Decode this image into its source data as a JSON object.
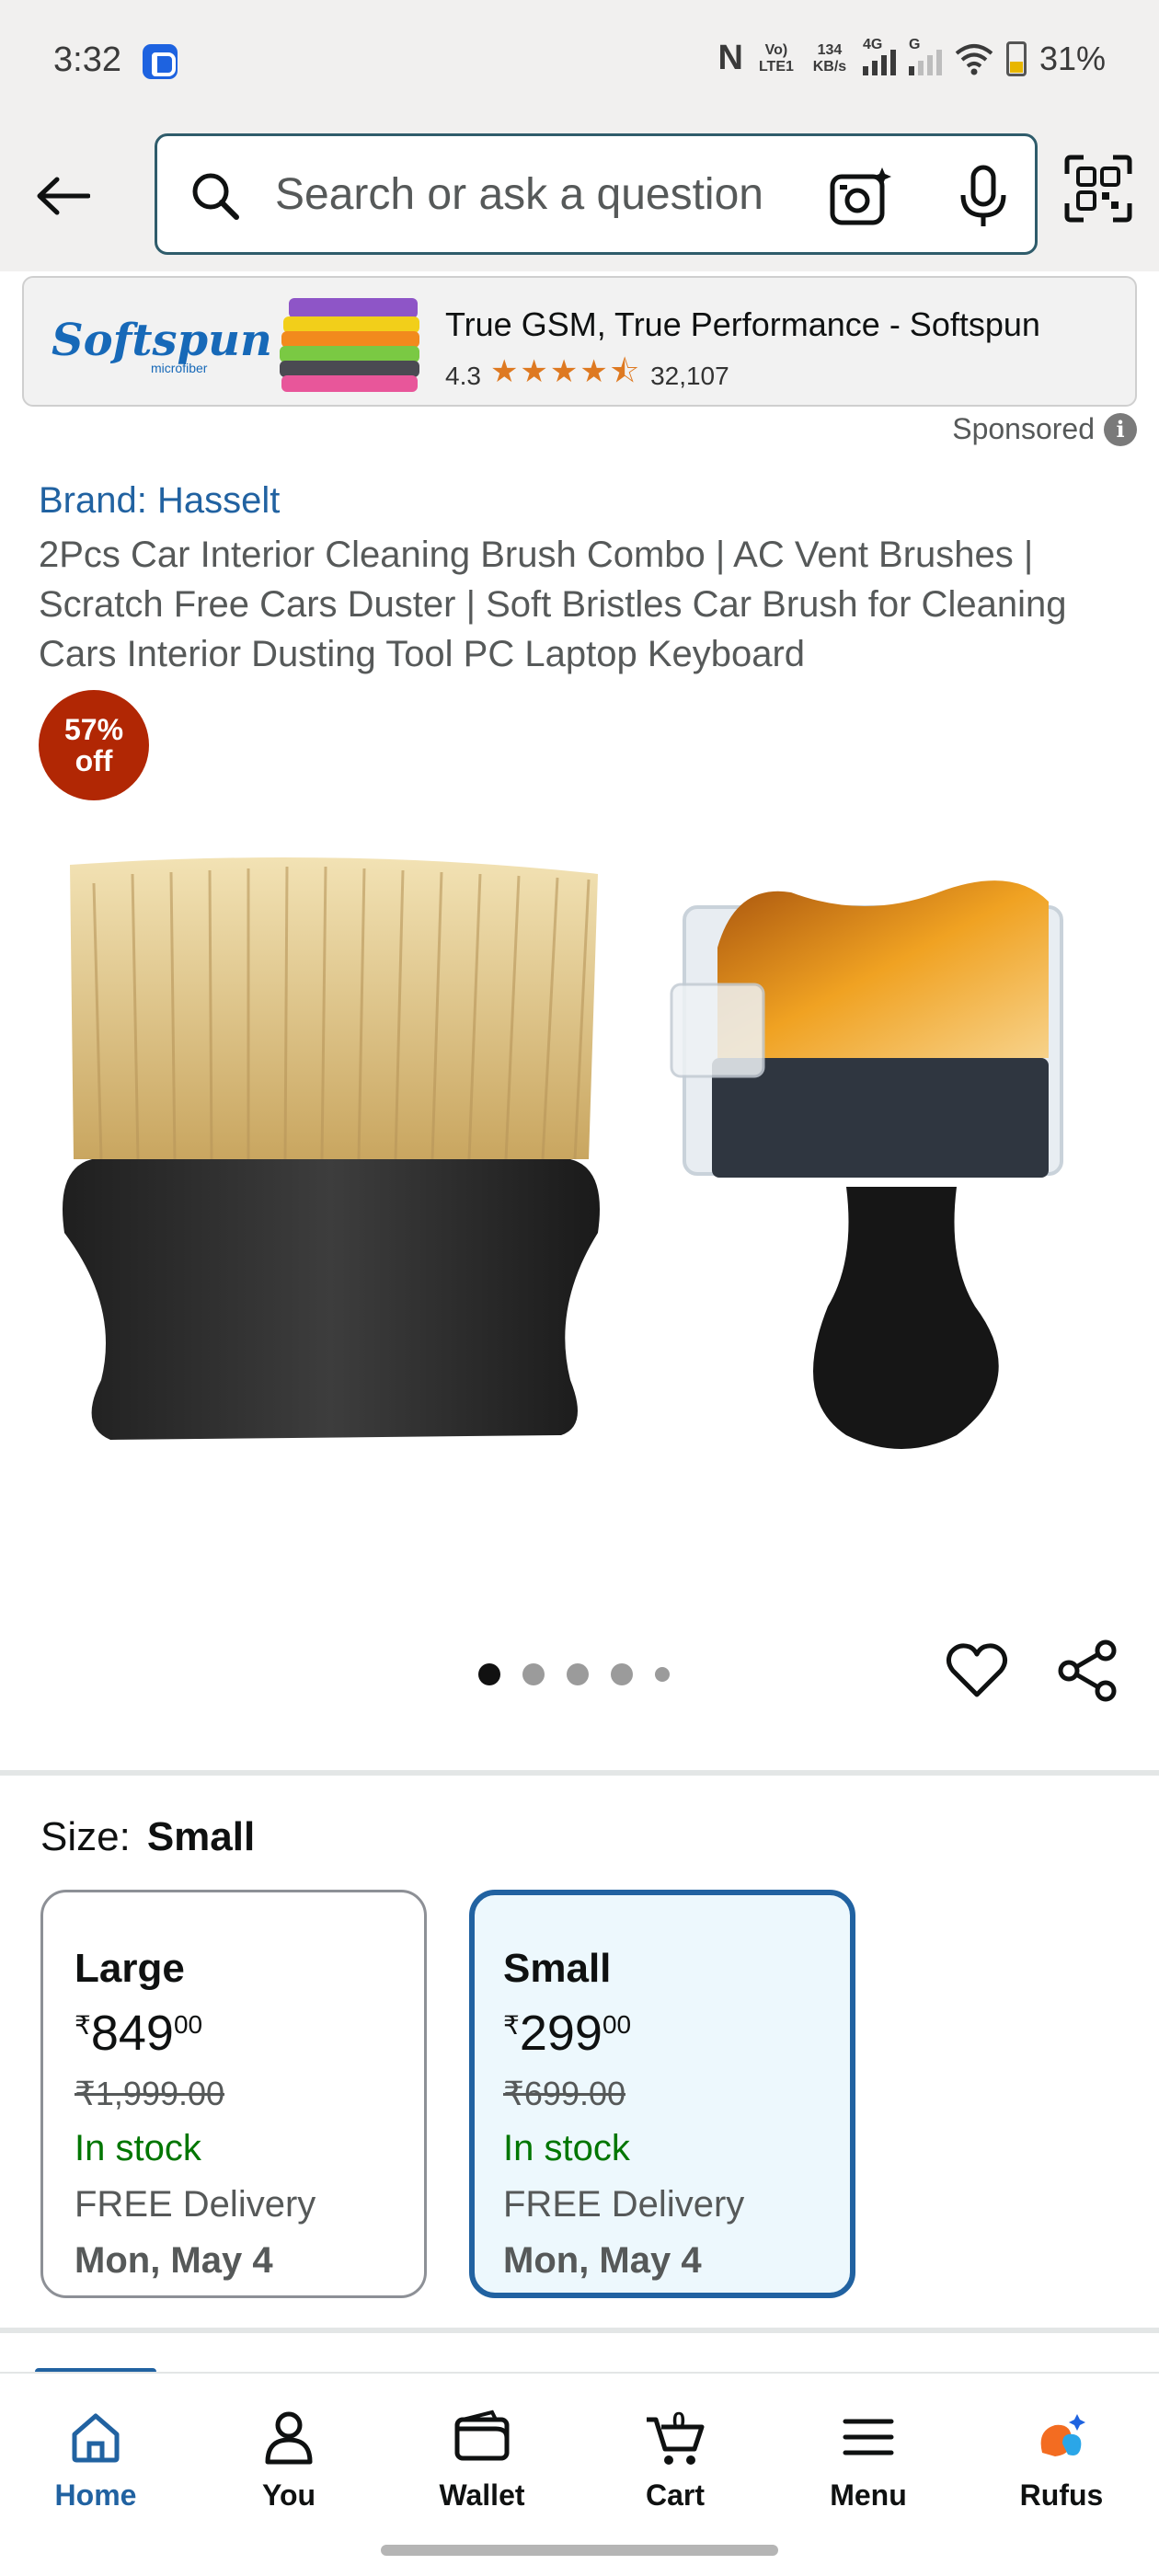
{
  "status_bar": {
    "time": "3:32",
    "network_text_1": "Vo) LTE1",
    "network_speed": "134 KB/s",
    "network_4g": "4G",
    "network_g": "G",
    "battery": "31%"
  },
  "search": {
    "placeholder": "Search or ask a question"
  },
  "ad": {
    "logo": "Softspun",
    "logo_sub": "microfiber",
    "title": "True GSM, True Performance - Softspun",
    "rating": "4.3",
    "stars": "★★★★⯪",
    "review_count": "32,107",
    "sponsored_label": "Sponsored"
  },
  "product": {
    "brand": "Brand: Hasselt",
    "title": "2Pcs Car Interior Cleaning Brush Combo | AC Vent Brushes | Scratch Free Cars Duster | Soft Bristles Car Brush for Cleaning Cars Interior Dusting Tool PC Laptop Keyboard",
    "discount_pct": "57%",
    "discount_off": "off",
    "image_count": 5,
    "active_image_index": 0
  },
  "size": {
    "label": "Size:",
    "selected": "Small",
    "options": [
      {
        "name": "Large",
        "currency": "₹",
        "price_whole": "849",
        "price_fraction": "00",
        "mrp": "₹1,999.00",
        "stock": "In stock",
        "delivery": "FREE Delivery",
        "delivery_date": "Mon, May 4",
        "selected": false
      },
      {
        "name": "Small",
        "currency": "₹",
        "price_whole": "299",
        "price_fraction": "00",
        "mrp": "₹699.00",
        "stock": "In stock",
        "delivery": "FREE Delivery",
        "delivery_date": "Mon, May 4",
        "selected": true
      }
    ]
  },
  "bottom_nav": {
    "items": [
      {
        "label": "Home",
        "icon": "home-icon",
        "active": true
      },
      {
        "label": "You",
        "icon": "user-icon",
        "active": false
      },
      {
        "label": "Wallet",
        "icon": "wallet-icon",
        "active": false
      },
      {
        "label": "Cart",
        "icon": "cart-icon",
        "active": false,
        "count": "0"
      },
      {
        "label": "Menu",
        "icon": "menu-icon",
        "active": false
      },
      {
        "label": "Rufus",
        "icon": "rufus-icon",
        "active": false
      }
    ]
  },
  "colors": {
    "link_blue": "#2162a1",
    "discount_red": "#b12704",
    "in_stock_green": "#007600",
    "header_bg": "#f1f0ef",
    "selected_card_bg": "#edf8fd",
    "star_orange": "#de7921"
  }
}
